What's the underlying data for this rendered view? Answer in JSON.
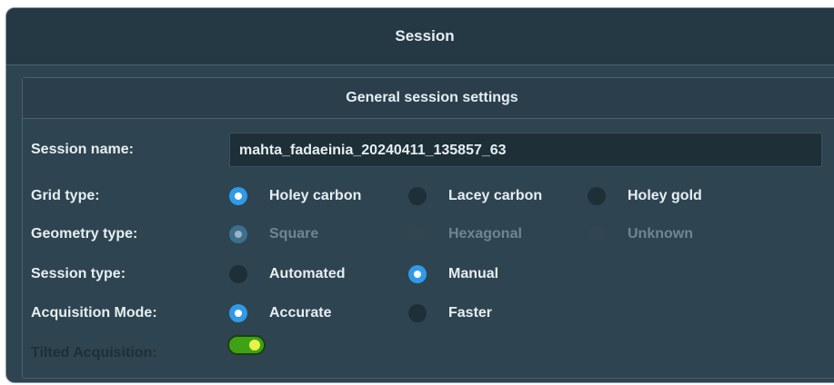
{
  "window": {
    "title": "Session"
  },
  "panel": {
    "title": "General session settings"
  },
  "session_name": {
    "label": "Session name:",
    "value": "mahta_fadaeinia_20240411_135857_63"
  },
  "grid_type": {
    "label": "Grid type:",
    "options": [
      "Holey carbon",
      "Lacey carbon",
      "Holey gold"
    ],
    "selected": "Holey carbon"
  },
  "geometry_type": {
    "label": "Geometry type:",
    "options": [
      "Square",
      "Hexagonal",
      "Unknown"
    ],
    "selected": "Square",
    "disabled": true
  },
  "session_type": {
    "label": "Session type:",
    "options": [
      "Automated",
      "Manual"
    ],
    "selected": "Manual"
  },
  "acquisition_mode": {
    "label": "Acquisition Mode:",
    "options": [
      "Accurate",
      "Faster"
    ],
    "selected": "Accurate"
  },
  "tilted_acquisition": {
    "label": "Tilted Acquisition:",
    "enabled": true
  },
  "colors": {
    "window_bg": "#2e4450",
    "title_bg": "#253944",
    "radio_checked": "#2f9ae8",
    "toggle_on": "#3fa214",
    "highlight": "#d6e10a"
  }
}
